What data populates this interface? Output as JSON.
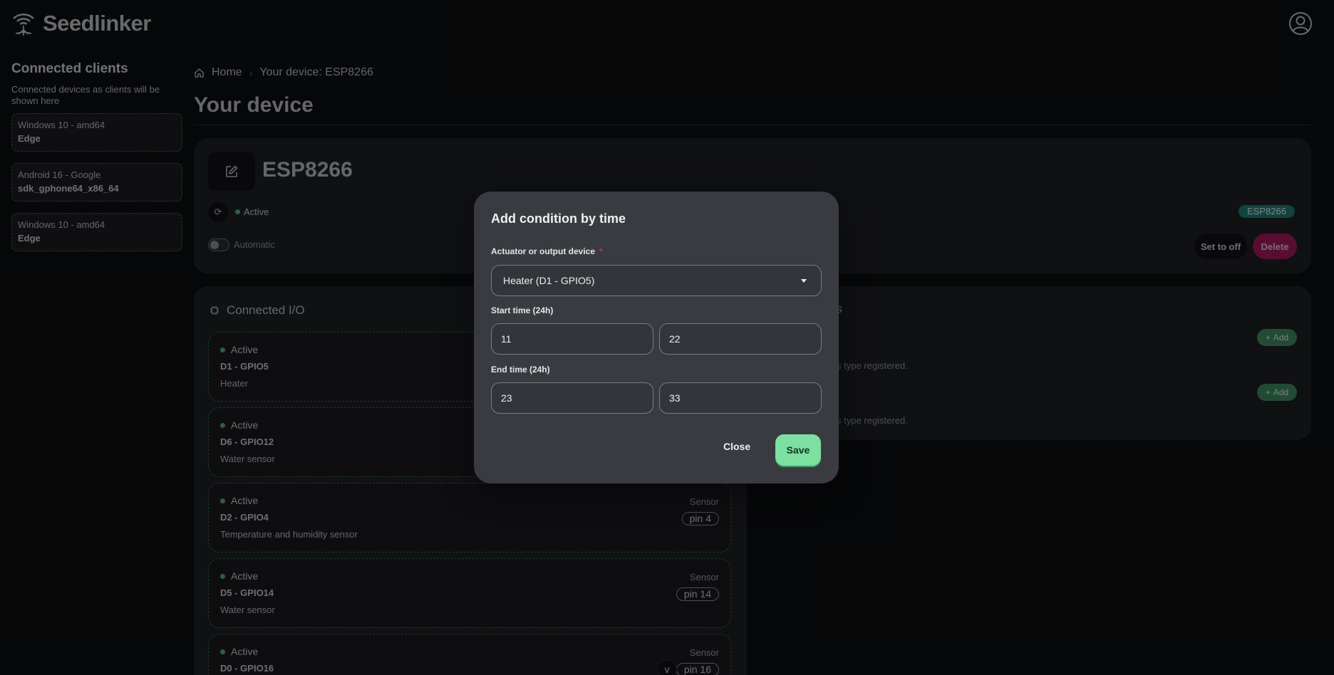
{
  "app": {
    "name": "Seedlinker",
    "logo_icon": "wifi-roots-icon",
    "user_icon": "user-circle-icon"
  },
  "sidebar": {
    "title": "Connected clients",
    "description": "Connected devices as clients will be shown here",
    "clients": [
      {
        "os": "Windows 10 - amd64",
        "browser": "Edge"
      },
      {
        "os": "Android 16 - Google",
        "browser": "sdk_gphone64_x86_64"
      },
      {
        "os": "Windows 10 - amd64",
        "browser": "Edge"
      }
    ]
  },
  "breadcrumb": {
    "home": "Home",
    "current": "Your device: ESP8266"
  },
  "page": {
    "title": "Your device"
  },
  "device": {
    "name": "ESP8266",
    "status": "Active",
    "mode_label": "Automatic",
    "mode_on": false,
    "badge": "ESP8266",
    "set_off_label": "Set to off",
    "delete_label": "Delete"
  },
  "io": {
    "title": "Connected I/O",
    "items": [
      {
        "status": "Active",
        "pin": "D1 - GPIO5",
        "desc": "Heater",
        "type": "",
        "pinbadge": ""
      },
      {
        "status": "Active",
        "pin": "D6 - GPIO12",
        "desc": "Water sensor",
        "type": "",
        "pinbadge": ""
      },
      {
        "status": "Active",
        "pin": "D2 - GPIO4",
        "desc": "Temperature and humidity sensor",
        "type": "Sensor",
        "pinbadge": "pin 4"
      },
      {
        "status": "Active",
        "pin": "D5 - GPIO14",
        "desc": "Water sensor",
        "type": "Sensor",
        "pinbadge": "pin 14"
      },
      {
        "status": "Active",
        "pin": "D0 - GPIO16",
        "desc": "",
        "type": "Sensor",
        "pinbadge": "pin 16"
      }
    ]
  },
  "conditions": {
    "title_fragment": "ns",
    "empty_text": "his type registered.",
    "add_label": "Add"
  },
  "modal": {
    "title": "Add condition by time",
    "actuator_label": "Actuator or output device",
    "required_mark": "*",
    "actuator_value": "Heater (D1 - GPIO5)",
    "start_label": "Start time (24h)",
    "start_hour": "11",
    "start_minute": "22",
    "end_label": "End time (24h)",
    "end_hour": "23",
    "end_minute": "33",
    "close_label": "Close",
    "save_label": "Save"
  },
  "colors": {
    "accent": "#7ce0a0",
    "delete": "#a3185e",
    "badge": "#1f7a73",
    "active": "#4fb07a"
  }
}
